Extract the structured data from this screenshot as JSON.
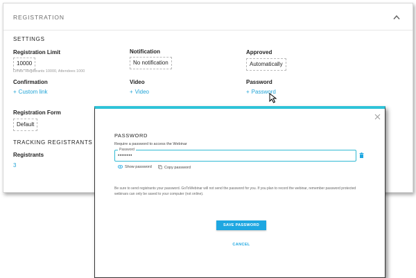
{
  "card": {
    "title": "REGISTRATION",
    "settings_title": "SETTINGS",
    "registration_limit": {
      "label": "Registration Limit",
      "value": "10000",
      "hint": "Limits: Registrants 10000, Attendees 1000"
    },
    "notification": {
      "label": "Notification",
      "value": "No notification"
    },
    "approved": {
      "label": "Approved",
      "value": "Automatically"
    },
    "confirmation": {
      "label": "Confirmation",
      "link": "Custom link"
    },
    "video": {
      "label": "Video",
      "link": "Video"
    },
    "password": {
      "label": "Password",
      "link": "Password"
    },
    "registration_form": {
      "label": "Registration Form",
      "value": "Default"
    },
    "tracking_title": "TRACKING REGISTRANTS",
    "registrants": {
      "label": "Registrants",
      "count": "3"
    }
  },
  "modal": {
    "title": "PASSWORD",
    "description": "Require a password to access the Webinar",
    "field_label": "Password",
    "field_value": "••••••••",
    "show_password": "Show password",
    "copy_password": "Copy password",
    "note": "Be sure to send registrants your password. GoToWebinar will not send the password for you. If you plan to record the webinar, remember password protected webinars can only be saved to your computer (not online).",
    "save_label": "SAVE PASSWORD",
    "cancel_label": "CANCEL"
  },
  "colors": {
    "accent": "#1fa3d6",
    "modal_top_border": "#2fc3d8",
    "button": "#1ea7e1"
  },
  "icons": [
    "chevron-up-icon",
    "cursor-icon",
    "close-icon",
    "trash-icon",
    "eye-icon",
    "copy-icon"
  ]
}
